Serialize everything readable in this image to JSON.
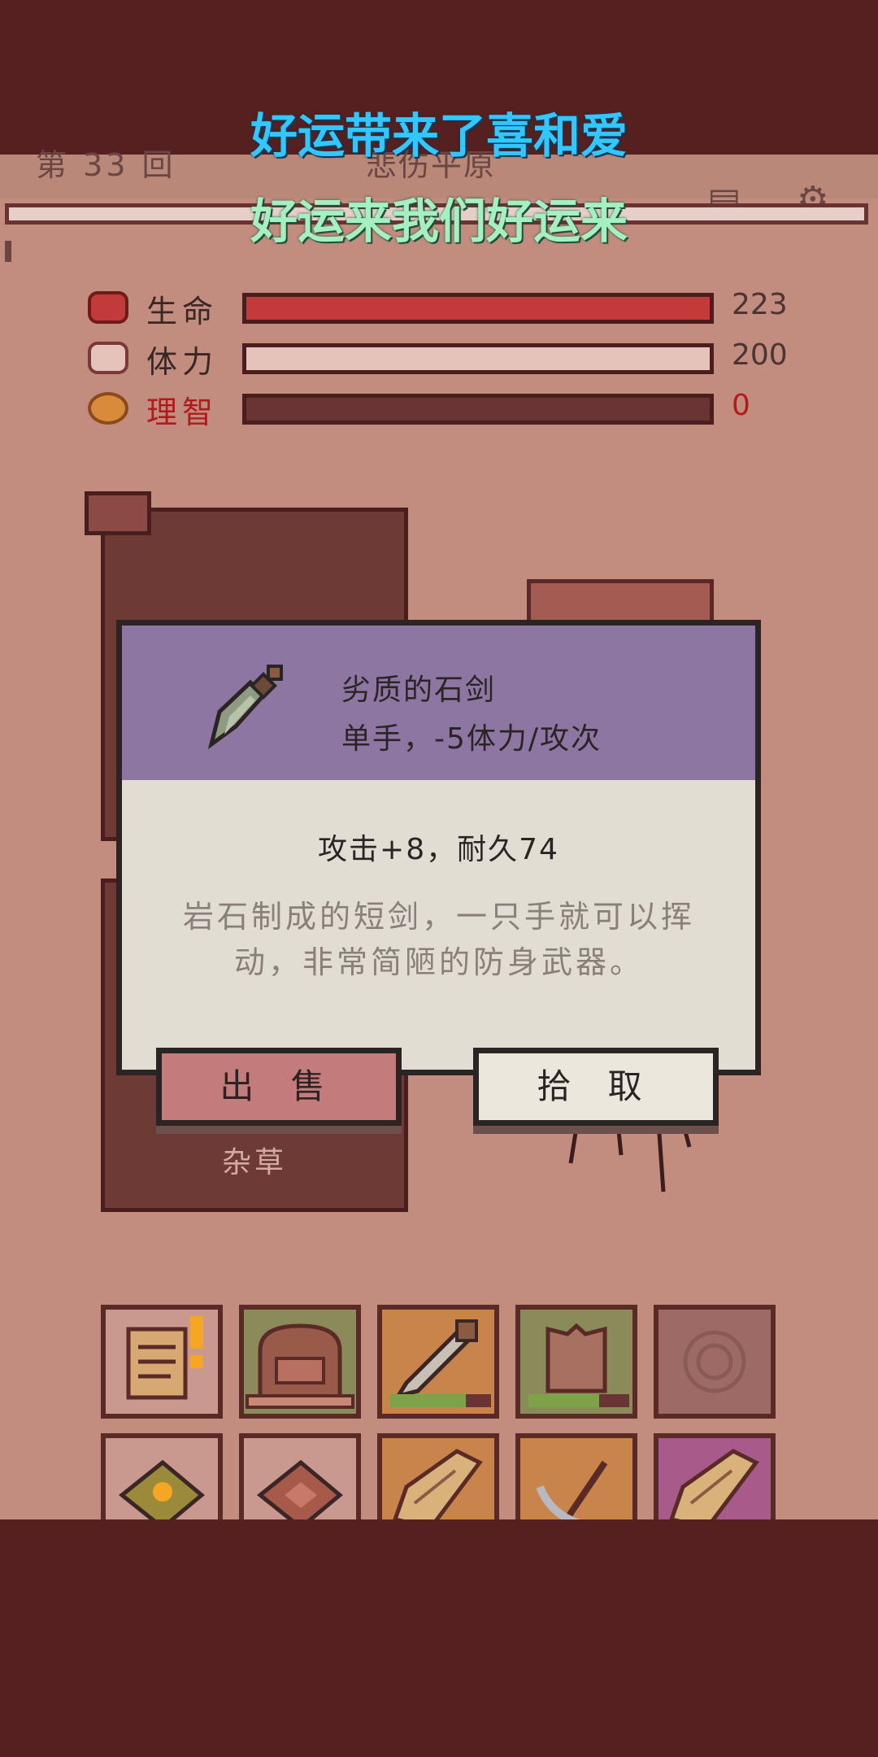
{
  "header": {
    "round": "第 33 回",
    "location": "悲伤平原",
    "map_icon": "map-icon",
    "settings_icon": "gear-icon"
  },
  "lyrics": {
    "line1": "好运带来了喜和爱",
    "line2": "好运来我们好运来"
  },
  "stats": [
    {
      "label": "生命",
      "value": "223",
      "icon": "heart-icon",
      "color": "#c23a3a",
      "fill": 1.0
    },
    {
      "label": "体力",
      "value": "200",
      "icon": "stamina-icon",
      "color": "#e6c3ba",
      "fill": 1.0
    },
    {
      "label": "理智",
      "value": "0",
      "icon": "sanity-icon",
      "color": "#b01c1c",
      "fill": 0.0
    }
  ],
  "scene": {
    "card_label": "杂草"
  },
  "item_dialog": {
    "name": "劣质的石剑",
    "type": "单手，-5体力/攻次",
    "stats": "攻击+8，耐久74",
    "description": "岩石制成的短剑，一只手就可以挥动，非常简陋的防身武器。",
    "sell_label": "出 售",
    "pickup_label": "拾 取",
    "icon": "stone-sword-icon"
  },
  "inventory": {
    "row1": [
      {
        "name": "quest-scroll-icon",
        "alert": true
      },
      {
        "name": "backpack-icon",
        "durability": null
      },
      {
        "name": "sword-icon",
        "durability": 0.75
      },
      {
        "name": "armor-icon",
        "durability": 0.7
      },
      {
        "name": "empty-slot-icon"
      }
    ],
    "row2": [
      {
        "name": "recipe-book-icon"
      },
      {
        "name": "spellbook-icon"
      },
      {
        "name": "map-scroll-icon"
      },
      {
        "name": "pickaxe-icon"
      },
      {
        "name": "map-scroll-icon"
      }
    ]
  },
  "colors": {
    "background": "#c28d7e",
    "dark_band": "#55201f",
    "dialog_header": "#8e76a2",
    "sell_button": "#c47b7b"
  }
}
